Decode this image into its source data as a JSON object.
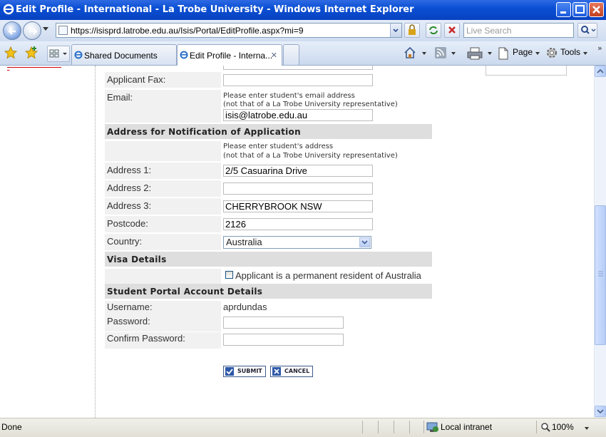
{
  "window": {
    "title": "Edit Profile - International - La Trobe University - Windows Internet Explorer"
  },
  "addressbar": {
    "url": "https://isisprd.latrobe.edu.au/Isis/Portal/EditProfile.aspx?mi=9",
    "search_placeholder": "Live Search"
  },
  "tabs": [
    {
      "label": "Shared Documents"
    },
    {
      "label": "Edit Profile - Interna..."
    }
  ],
  "commands": {
    "page": "Page",
    "tools": "Tools"
  },
  "form": {
    "fax_label": "Applicant Fax:",
    "fax_value": "",
    "email_label": "Email:",
    "email_hint_1": "Please enter student's email address",
    "email_hint_2": "(not that of a La Trobe University representative)",
    "email_value": "isis@latrobe.edu.au",
    "address_section": "Address for Notification of Application",
    "address_hint_1": "Please enter student's address",
    "address_hint_2": "(not that of a La Trobe University representative)",
    "address1_label": "Address 1:",
    "address1_value": "2/5 Casuarina Drive",
    "address2_label": "Address 2:",
    "address2_value": "",
    "address3_label": "Address 3:",
    "address3_value": "CHERRYBROOK NSW",
    "postcode_label": "Postcode:",
    "postcode_value": "2126",
    "country_label": "Country:",
    "country_value": "Australia",
    "visa_section": "Visa Details",
    "permanent_resident_label": "Applicant is a permanent resident of Australia",
    "permanent_resident_checked": false,
    "account_section": "Student Portal Account Details",
    "username_label": "Username:",
    "username_value": "aprdundas",
    "password_label": "Password:",
    "confirm_password_label": "Confirm Password:",
    "submit_label": "SUBMIT",
    "cancel_label": "CANCEL"
  },
  "status": {
    "left": "Done",
    "zone": "Local intranet",
    "zoom": "100%"
  }
}
